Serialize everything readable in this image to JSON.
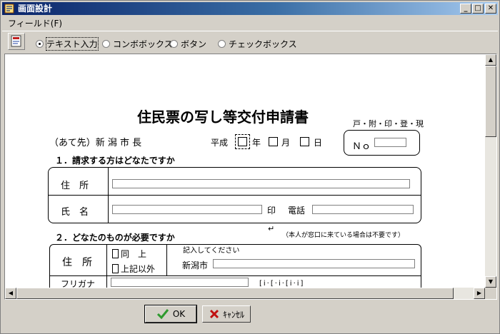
{
  "window": {
    "title": "画面設計"
  },
  "titlebar_buttons": {
    "min": "_",
    "max": "□",
    "close": "✕"
  },
  "menu": {
    "field": "フィールド(F)"
  },
  "toolbar": {
    "radios": [
      {
        "label": "テキスト入力",
        "selected": true
      },
      {
        "label": "コンボボックス",
        "selected": false
      },
      {
        "label": "ボタン",
        "selected": false
      },
      {
        "label": "チェックボックス",
        "selected": false
      }
    ]
  },
  "form": {
    "title": "住民票の写し等交付申請書",
    "kinds": "戸・附・印・登・現",
    "to": "（あて先）新 潟 市 長",
    "era": "平成",
    "year": "年",
    "month": "月",
    "day": "日",
    "no": "Ｎｏ",
    "section1": "１．請求する方はどなたですか",
    "address": "住　所",
    "name": "氏　名",
    "seal": "印",
    "phone": "電話",
    "note": "（本人が窓口に来ている場合は不要です）",
    "section2": "２．どなたのものが必要ですか",
    "address2": "住　所",
    "same": "同　上",
    "other": "上記以外",
    "please": "記入してください",
    "city": "新潟市",
    "furigana": "フリガナ"
  },
  "buttons": {
    "ok": "OK",
    "cancel": "ｷｬﾝｾﾙ"
  },
  "colors": {
    "title_start": "#0a246a",
    "title_end": "#a6caf0",
    "ok_check": "#2e9a2e",
    "cancel_x": "#c01010"
  }
}
